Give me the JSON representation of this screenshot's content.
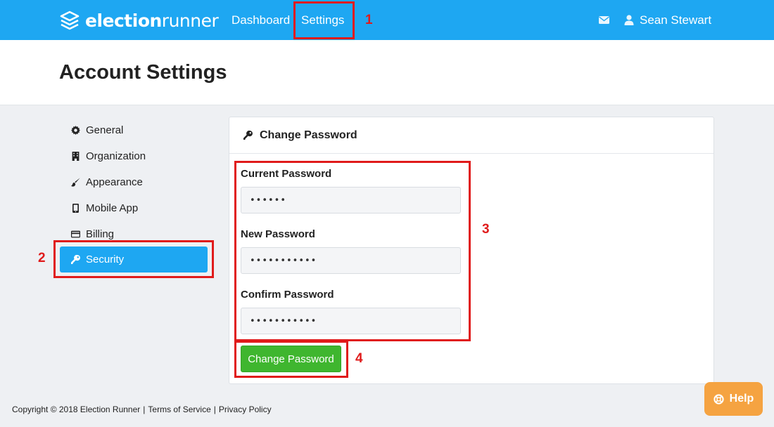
{
  "brand": {
    "name_bold": "election",
    "name_light": "runner"
  },
  "nav": {
    "dashboard": "Dashboard",
    "settings": "Settings",
    "user_name": "Sean Stewart"
  },
  "page": {
    "title": "Account Settings"
  },
  "sidebar": {
    "items": [
      {
        "label": "General",
        "icon": "gear-icon"
      },
      {
        "label": "Organization",
        "icon": "building-icon"
      },
      {
        "label": "Appearance",
        "icon": "paintbrush-icon"
      },
      {
        "label": "Mobile App",
        "icon": "mobile-icon"
      },
      {
        "label": "Billing",
        "icon": "credit-card-icon"
      },
      {
        "label": "Security",
        "icon": "key-icon",
        "active": true
      }
    ]
  },
  "card": {
    "title": "Change Password",
    "current": {
      "label": "Current Password",
      "value": "••••••"
    },
    "new": {
      "label": "New Password",
      "value": "•••••••••••"
    },
    "confirm": {
      "label": "Confirm Password",
      "value": "•••••••••••"
    },
    "button": "Change Password"
  },
  "annotations": {
    "n1": "1",
    "n2": "2",
    "n3": "3",
    "n4": "4"
  },
  "footer": {
    "copyright": "Copyright © 2018 Election Runner",
    "sep": "|",
    "terms": "Terms of Service",
    "privacy": "Privacy Policy"
  },
  "help": {
    "label": "Help"
  },
  "colors": {
    "primary": "#1ea7f2",
    "success": "#3fb62f",
    "help": "#f5a341",
    "annotation": "#e01b1b"
  }
}
